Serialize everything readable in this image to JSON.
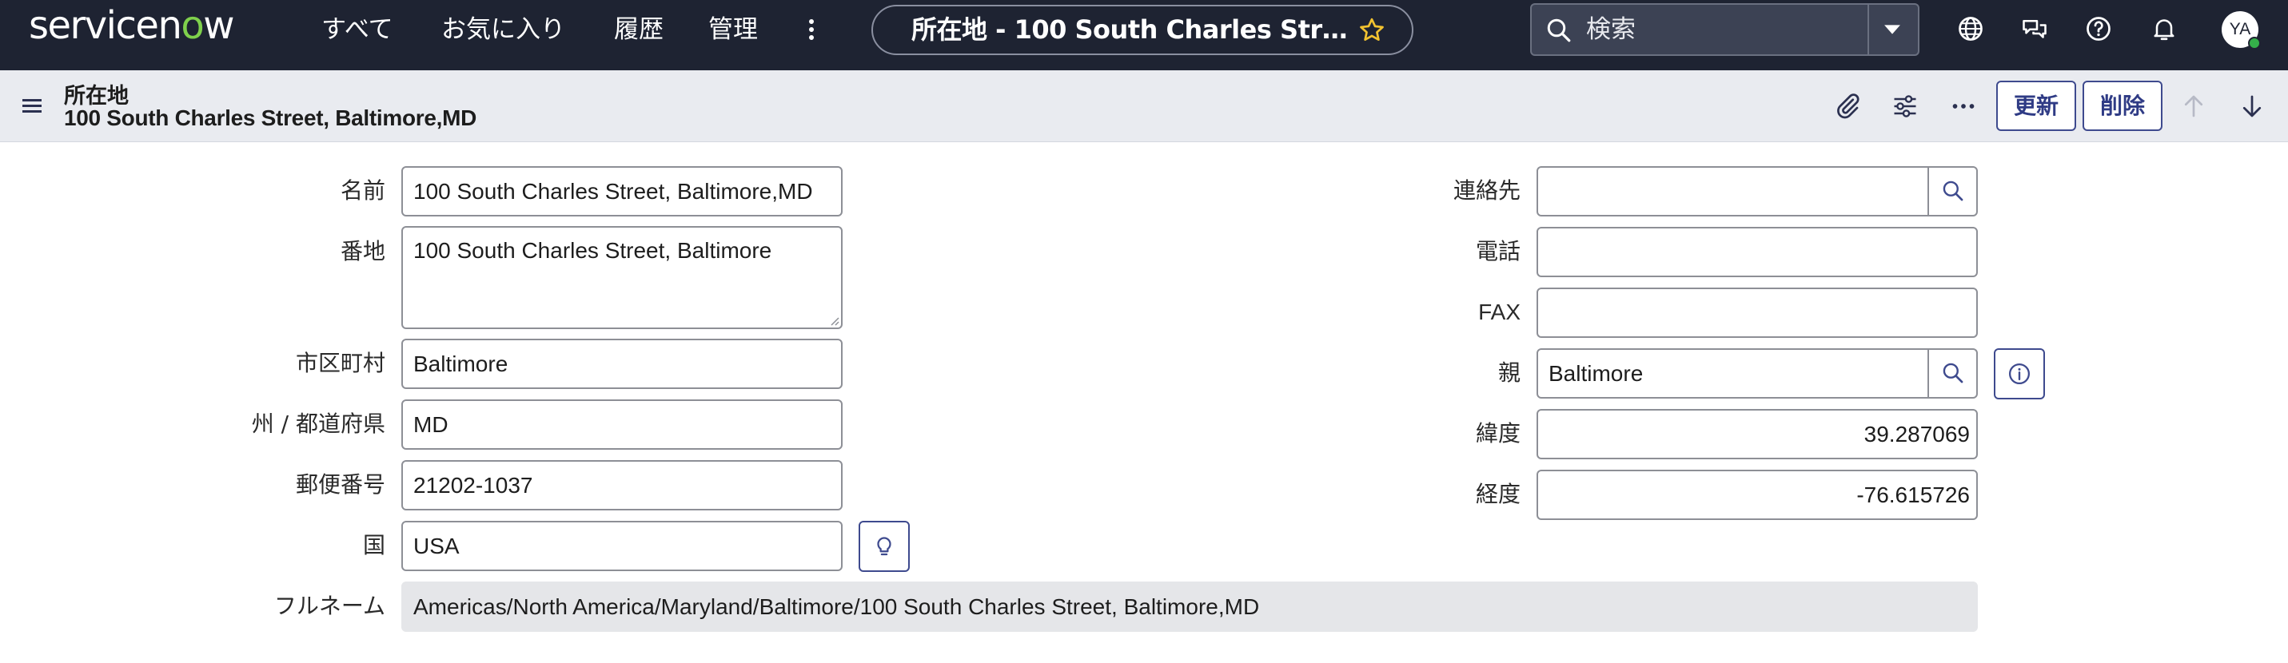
{
  "app": {
    "logo_text": "servicenow",
    "brand_color": "#1e2332",
    "accent_color": "#7fd04c"
  },
  "nav": {
    "items": [
      {
        "label": "すべて"
      },
      {
        "label": "お気に入り"
      },
      {
        "label": "履歴"
      },
      {
        "label": "管理"
      }
    ],
    "more_icon": "vertical-ellipsis-icon",
    "context_title": "所在地 - 100 South Charles Street, Baltimore,MD",
    "context_star_icon": "star-icon"
  },
  "search": {
    "placeholder": "検索",
    "icon": "search-icon",
    "scope_icon": "chevron-down-icon"
  },
  "top_icons": [
    "globe-icon",
    "chat-icon",
    "help-icon",
    "bell-icon"
  ],
  "user": {
    "initials": "YA",
    "status_color": "#35b04a"
  },
  "record": {
    "type": "所在地",
    "name": "100 South Charles Street, Baltimore,MD",
    "actions": {
      "update": "更新",
      "delete": "削除"
    },
    "action_icons": [
      "paperclip-icon",
      "sliders-icon",
      "more-horizontal-icon",
      "arrow-up-icon",
      "arrow-down-icon"
    ]
  },
  "form": {
    "name_label": "名前",
    "name_value": "100 South Charles Street, Baltimore,MD",
    "street_label": "番地",
    "street_value": "100 South Charles Street, Baltimore",
    "city_label": "市区町村",
    "city_value": "Baltimore",
    "state_label": "州 / 都道府県",
    "state_value": "MD",
    "zip_label": "郵便番号",
    "zip_value": "21202-1037",
    "country_label": "国",
    "country_value": "USA",
    "fullname_label": "フルネーム",
    "fullname_value": "Americas/North America/Maryland/Baltimore/100 South Charles Street, Baltimore,MD",
    "contact_label": "連絡先",
    "contact_value": "",
    "phone_label": "電話",
    "phone_value": "",
    "fax_label": "FAX",
    "fax_value": "",
    "parent_label": "親",
    "parent_value": "Baltimore",
    "latitude_label": "緯度",
    "latitude_value": "39.287069",
    "longitude_label": "経度",
    "longitude_value": "-76.615726"
  }
}
